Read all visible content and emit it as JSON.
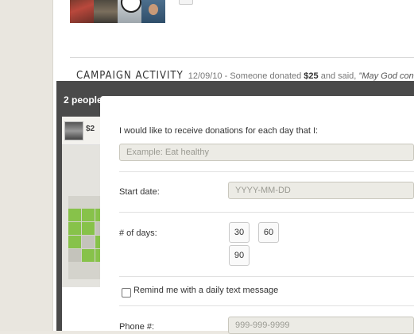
{
  "campaign": {
    "activity_label": "CAMPAIGN ACTIVITY",
    "activity_date": "12/09/10",
    "activity_prefix": " - Someone donated ",
    "activity_amount": "$25",
    "activity_middle": " and said, ",
    "activity_quote": "\"May God continue"
  },
  "overlay": {
    "title": "2 people",
    "amount": "$2"
  },
  "form": {
    "intro_label": "I would like to receive donations for each day that I:",
    "goal_placeholder": "Example: Eat healthy",
    "start_date_label": "Start date:",
    "start_date_placeholder": "YYYY-MM-DD",
    "days_label": "# of days:",
    "days_options": [
      "30",
      "60",
      "90"
    ],
    "remind_label": "Remind me with a daily text message",
    "remind_checked": false,
    "phone_label": "Phone #:",
    "phone_placeholder": "999-999-9999"
  },
  "colors": {
    "overlay_bg": "#4a4a4a",
    "grid_green": "#87c24a",
    "input_bg": "#ecebe5"
  }
}
